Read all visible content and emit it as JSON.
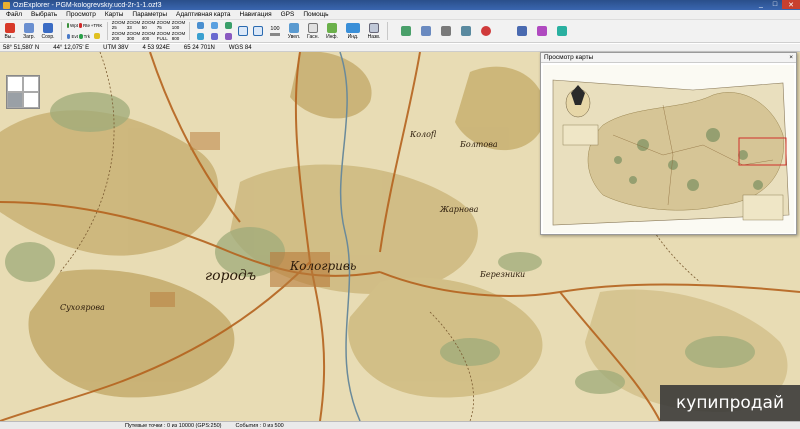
{
  "window": {
    "title": "OziExplorer - PGM-kologrevskiy.ucd-2r-1-1.ozf3",
    "minimize": "_",
    "maximize": "□",
    "close": "✕"
  },
  "menu": [
    "Файл",
    "Выбрать",
    "Просмотр",
    "Карты",
    "Параметры",
    "Адаптивная карта",
    "Навигация",
    "GPS",
    "Помощь"
  ],
  "toolbar": {
    "main": [
      {
        "label": "Вы...",
        "icon": "close-map-icon",
        "color": "#d83a2a"
      },
      {
        "label": "Загр.",
        "icon": "load-icon",
        "color": "#6a8fd0"
      },
      {
        "label": "Сохр.",
        "icon": "save-icon",
        "color": "#3b6cc4"
      }
    ],
    "grid1": [
      {
        "label": "Wpt",
        "icon": "waypoint-icon",
        "color": "#3a8f3a"
      },
      {
        "label": "Evt",
        "icon": "event-icon",
        "color": "#4a7ac8"
      },
      {
        "label": "Rte",
        "icon": "route-icon",
        "color": "#d02828"
      },
      {
        "label": "Trk",
        "icon": "track-icon",
        "color": "#28a048"
      },
      {
        "label": "+TRK",
        "icon": "add-track-icon",
        "color": "#555555"
      },
      {
        "label": "",
        "icon": "clear-icon",
        "color": "#e0c020"
      }
    ],
    "zooms": [
      "ZOOM 25",
      "ZOOM 200",
      "ZOOM 33",
      "ZOOM 300",
      "ZOOM 50",
      "ZOOM 400",
      "ZOOM 75",
      "ZOOM FULL",
      "ZOOM 100",
      "ZOOM 800"
    ],
    "tools": [
      {
        "label": "",
        "icon": "map-tool-icon",
        "color": "#4a8fd0"
      },
      {
        "label": "",
        "icon": "gps-tool-icon",
        "color": "#3aa0d0"
      }
    ],
    "find": {
      "icon": "magnifier-icon",
      "color": "#2a6ab0"
    },
    "zoom_value": "100",
    "right": [
      {
        "label": "Увел.",
        "icon": "zoom-icon"
      },
      {
        "label": "Гасн.",
        "icon": "dim-icon"
      },
      {
        "label": "Инф.",
        "icon": "info-icon"
      },
      {
        "label": "Инд.",
        "icon": "indicator-icon"
      },
      {
        "label": "Назв.",
        "icon": "name-icon"
      }
    ]
  },
  "coords": {
    "lat": "58° 51,580' N",
    "lon": "44° 12,075' E",
    "utm": "UTM  38V",
    "utm_e": "4 53 924E",
    "utm_n": "65 24 701N",
    "datum": "WGS 84"
  },
  "preview": {
    "title": "Просмотр карты",
    "close": "×"
  },
  "status": {
    "waypoints": "Путевые точки : 0 из 10000  (GPS:250)",
    "events": "События : 0 из 500"
  },
  "watermark": "купипродай",
  "map_labels": [
    "Колоfl",
    "Кологривь",
    "городъ",
    "Сухоярова",
    "Жарнова",
    "Березники",
    "Болтова"
  ]
}
